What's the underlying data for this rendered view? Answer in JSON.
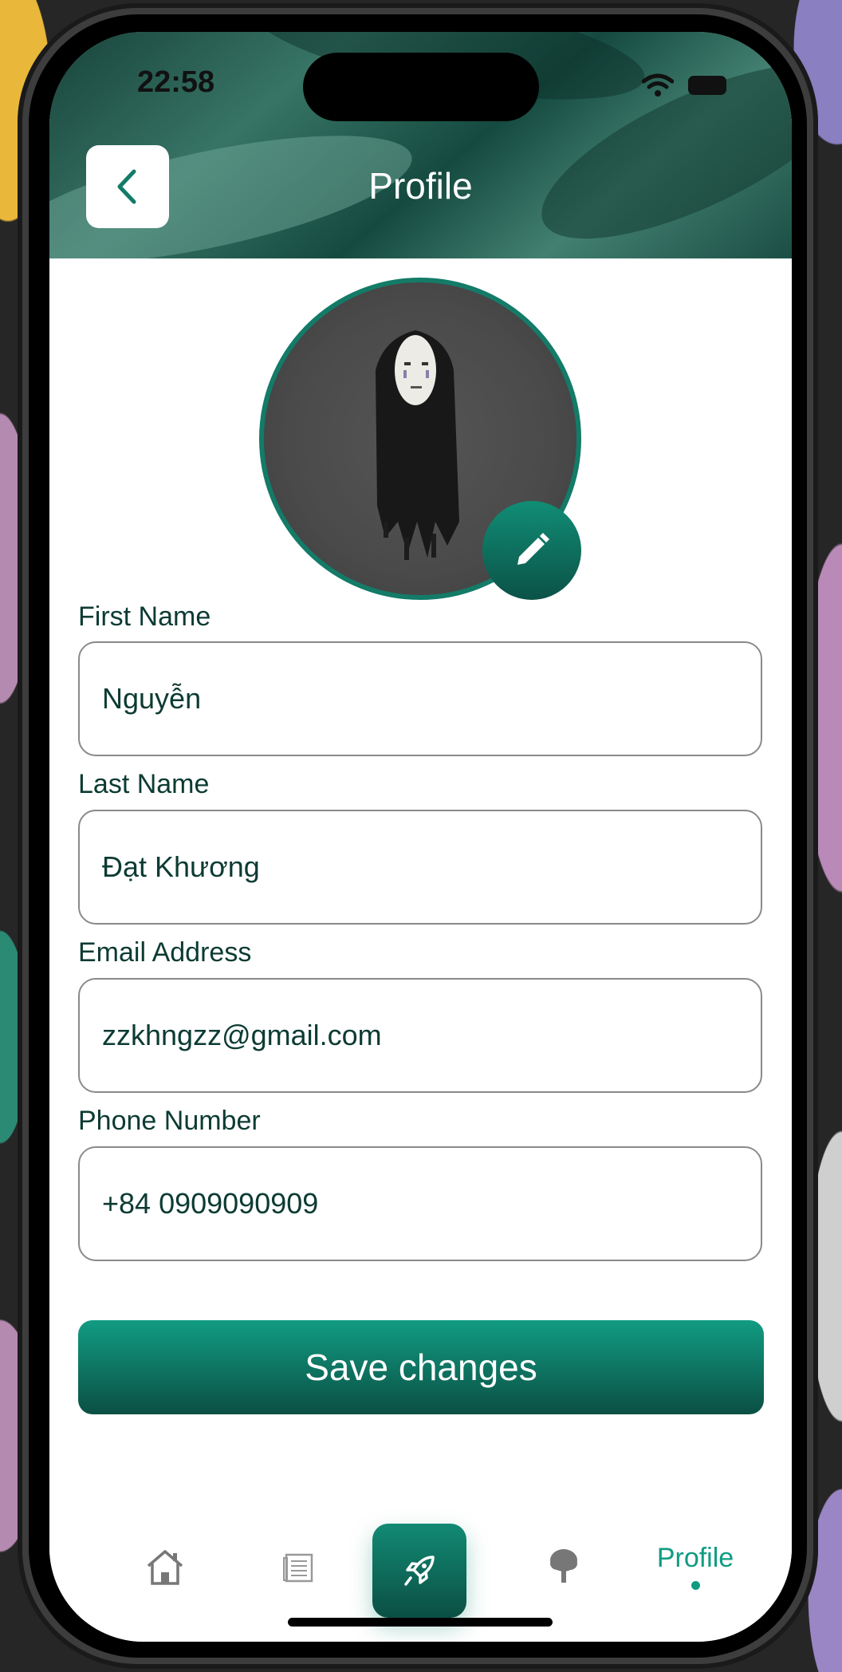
{
  "status_bar": {
    "time": "22:58"
  },
  "header": {
    "title": "Profile"
  },
  "form": {
    "first_name": {
      "label": "First Name",
      "value": "Nguyễn"
    },
    "last_name": {
      "label": "Last Name",
      "value": "Đạt Khương"
    },
    "email": {
      "label": "Email Address",
      "value": "zzkhngzz@gmail.com"
    },
    "phone": {
      "label": "Phone Number",
      "value": "+84 0909090909"
    }
  },
  "save_label": "Save changes",
  "tabbar": {
    "items": [
      {
        "icon": "home-icon"
      },
      {
        "icon": "document-icon"
      },
      {
        "icon": "rocket-icon"
      },
      {
        "icon": "tree-icon"
      },
      {
        "label": "Profile"
      }
    ],
    "active": "Profile"
  },
  "colors": {
    "accent": "#0f9c82",
    "accent_dark": "#0b4f44",
    "text": "#0c3b33"
  }
}
